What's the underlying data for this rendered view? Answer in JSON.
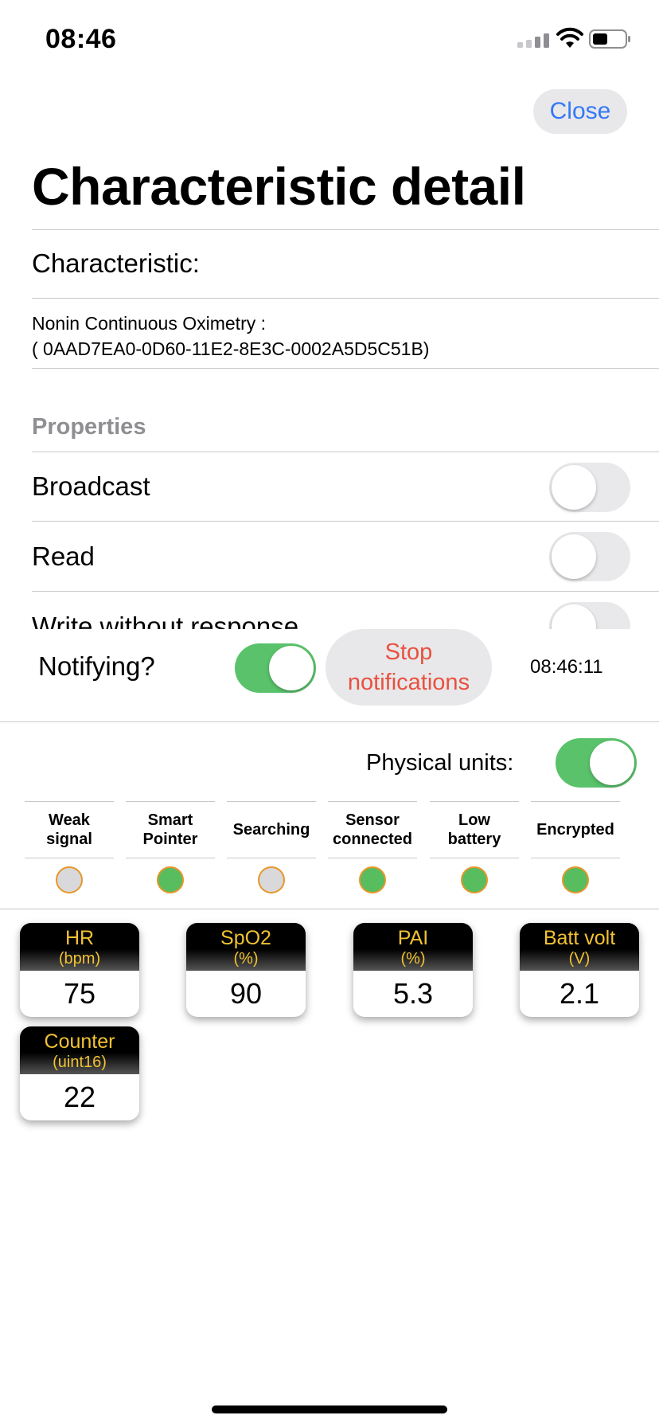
{
  "status_bar": {
    "time": "08:46"
  },
  "header": {
    "close_label": "Close",
    "title": "Characteristic detail"
  },
  "characteristic": {
    "label": "Characteristic:",
    "name": "Nonin Continuous Oximetry :",
    "uuid": "( 0AAD7EA0-0D60-11E2-8E3C-0002A5D5C51B)"
  },
  "properties": {
    "header": "Properties",
    "items": [
      {
        "label": "Broadcast",
        "on": false
      },
      {
        "label": "Read",
        "on": false
      },
      {
        "label": "Write without response",
        "on": false
      }
    ]
  },
  "notify": {
    "label": "Notifying?",
    "on": true,
    "stop_line1": "Stop",
    "stop_line2": "notifications",
    "time": "08:46:11"
  },
  "physical_units": {
    "label": "Physical units:",
    "on": true
  },
  "indicators": [
    {
      "line1": "Weak",
      "line2": "signal",
      "on": false
    },
    {
      "line1": "Smart",
      "line2": "Pointer",
      "on": true
    },
    {
      "line1": "Searching",
      "line2": "",
      "on": false
    },
    {
      "line1": "Sensor",
      "line2": "connected",
      "on": true
    },
    {
      "line1": "Low",
      "line2": "battery",
      "on": true
    },
    {
      "line1": "Encrypted",
      "line2": "",
      "on": true
    }
  ],
  "cards": [
    {
      "name": "HR",
      "unit": "(bpm)",
      "value": "75"
    },
    {
      "name": "SpO2",
      "unit": "(%)",
      "value": "90"
    },
    {
      "name": "PAI",
      "unit": "(%)",
      "value": "5.3"
    },
    {
      "name": "Batt volt",
      "unit": "(V)",
      "value": "2.1"
    },
    {
      "name": "Counter",
      "unit": "(uint16)",
      "value": "22"
    }
  ],
  "colors": {
    "accent_blue": "#3478f6",
    "stop_red": "#e8513f",
    "toggle_green": "#5ac26b",
    "lamp_green": "#57bd5f",
    "card_text_gold": "#f1c232"
  }
}
